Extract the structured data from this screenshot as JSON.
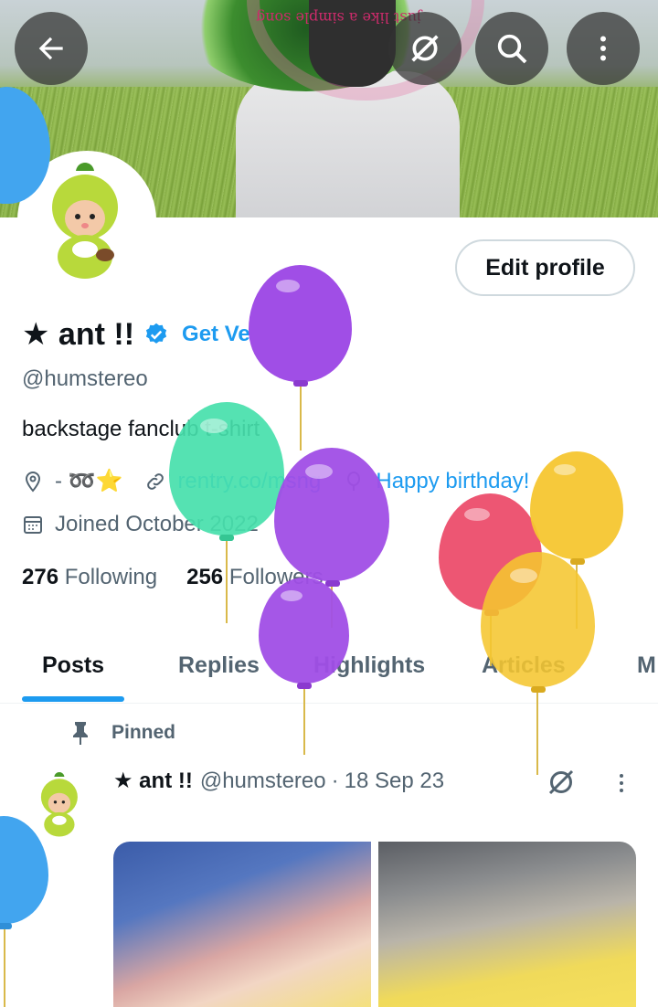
{
  "header": {
    "back_icon": "arrow-left-icon",
    "grok_icon": "grok-icon",
    "search_icon": "search-icon",
    "more_icon": "more-vertical-icon",
    "banner_text": "just like a simple song"
  },
  "profile": {
    "edit_label": "Edit profile",
    "display_name": "★ ant !!",
    "get_verified": "Get Verified",
    "handle": "@humstereo",
    "bio": "backstage fanclub t-shirt",
    "location": "- ➿⭐",
    "website": "rentry.co/msng",
    "birthday": "Happy birthday!",
    "joined": "Joined October 2022",
    "following_count": "276",
    "following_label": "Following",
    "followers_count": "256",
    "followers_label": "Followers"
  },
  "tabs": [
    {
      "label": "Posts"
    },
    {
      "label": "Replies"
    },
    {
      "label": "Highlights"
    },
    {
      "label": "Articles"
    },
    {
      "label": "M"
    }
  ],
  "pinned_post": {
    "pinned_label": "Pinned",
    "author_name": "★ ant !!",
    "author_handle": "@humstereo",
    "separator": "·",
    "date": "18 Sep 23"
  },
  "colors": {
    "accent": "#1d9bf0",
    "text_primary": "#0f1419",
    "text_secondary": "#536471",
    "border": "#cfd9de"
  }
}
